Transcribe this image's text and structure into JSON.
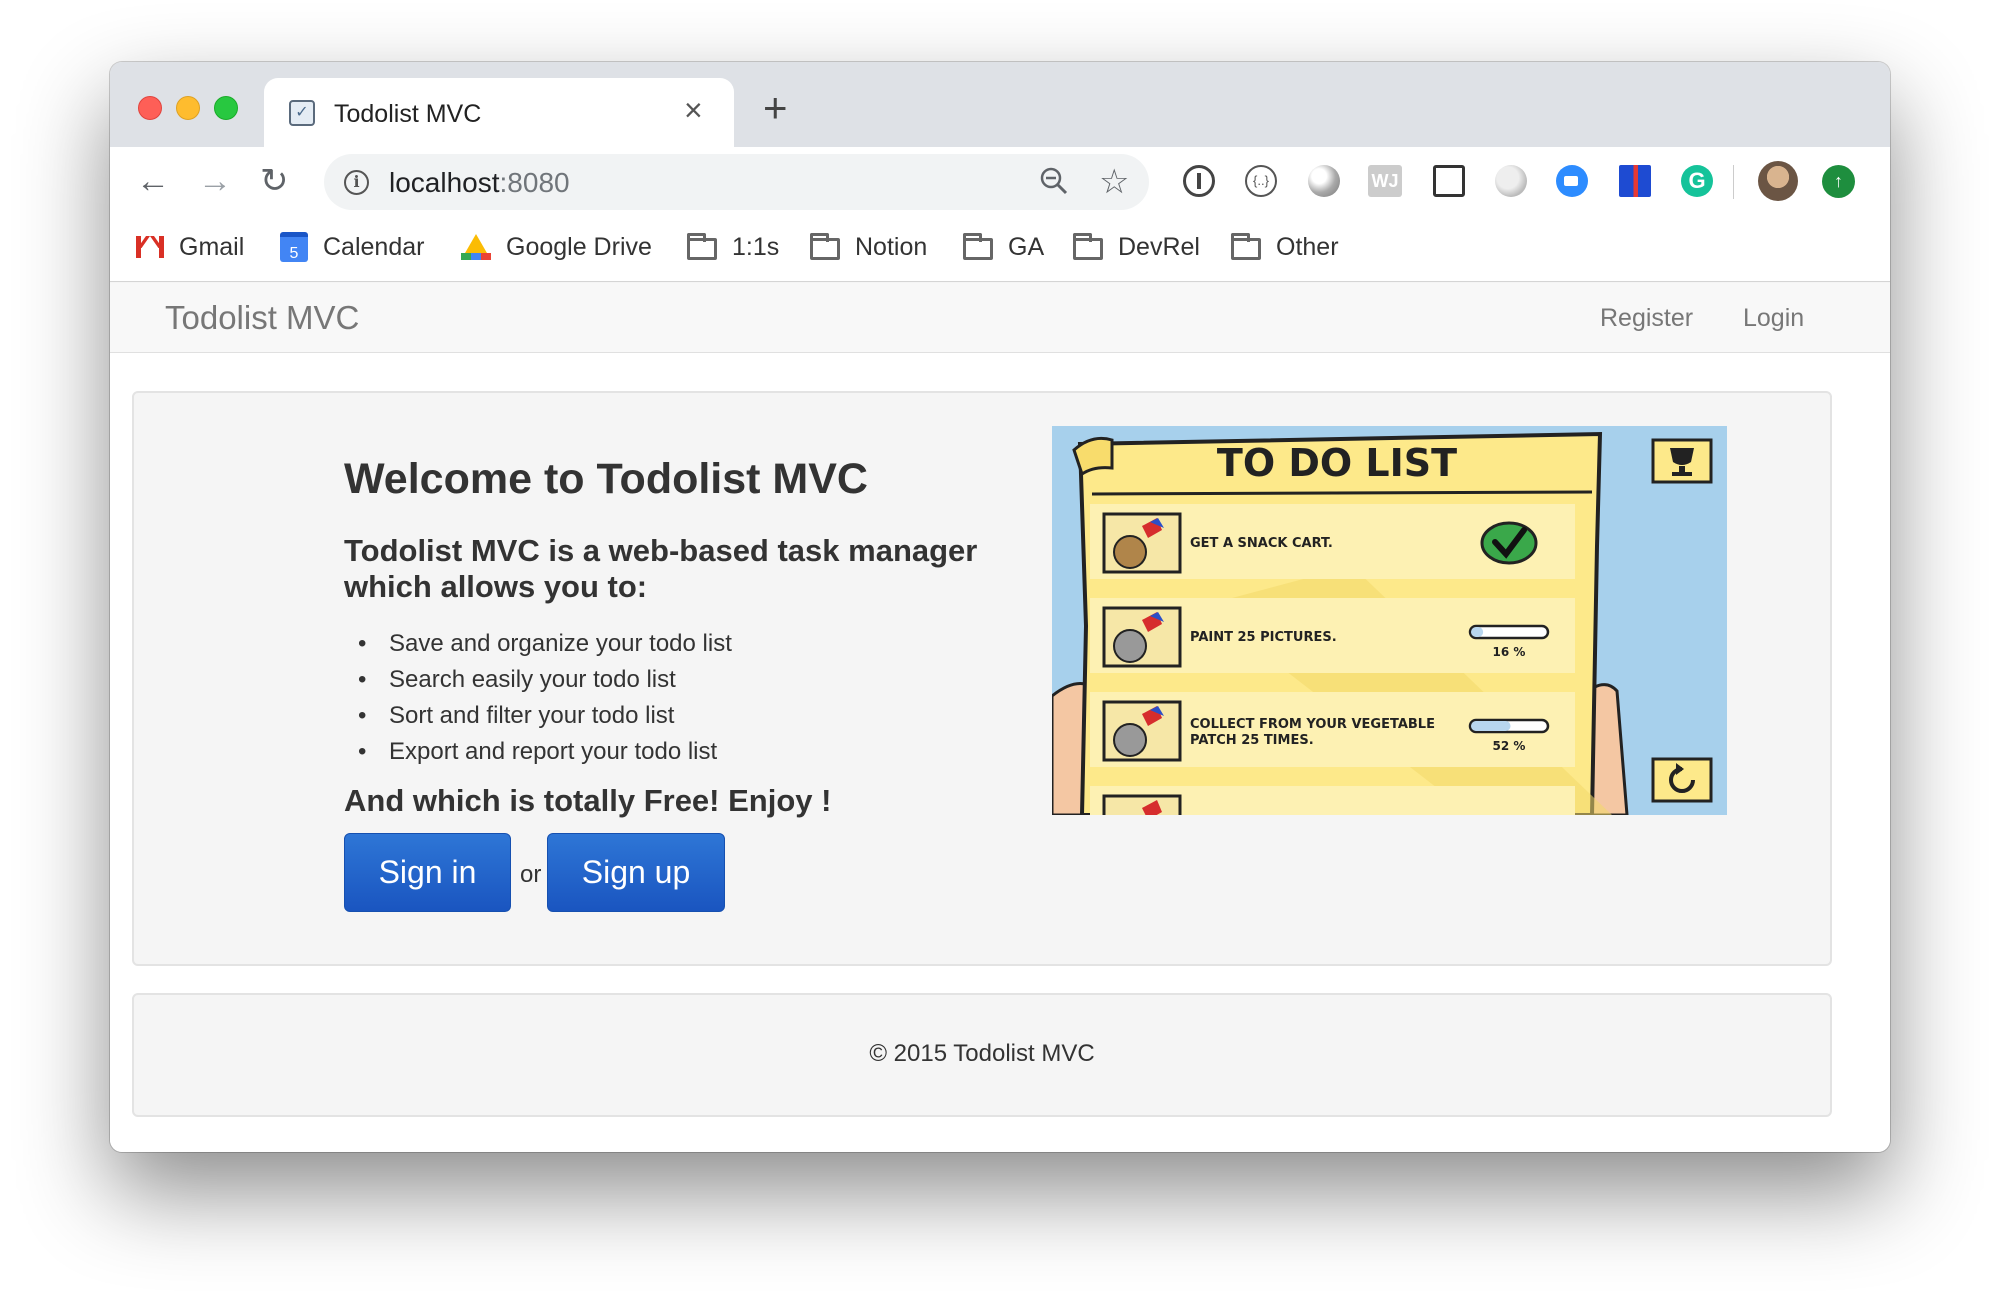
{
  "browser": {
    "tab_title": "Todolist MVC",
    "url_host": "localhost",
    "url_port": ":8080",
    "bookmarks": [
      "Gmail",
      "Calendar",
      "Google Drive",
      "1:1s",
      "Notion",
      "GA",
      "DevRel",
      "Other"
    ],
    "calendar_day": "5"
  },
  "navbar": {
    "brand": "Todolist MVC",
    "links": [
      "Register",
      "Login"
    ]
  },
  "hero": {
    "title": "Welcome to Todolist MVC",
    "subtitle": "Todolist MVC is a web-based task manager which allows you to:",
    "features": [
      "Save and organize your todo list",
      "Search easily your todo list",
      "Sort and filter your todo list",
      "Export and report your todo list"
    ],
    "tagline": "And which is totally Free! Enjoy !",
    "signin_label": "Sign in",
    "or_label": "or",
    "signup_label": "Sign up"
  },
  "illustration": {
    "heading": "TO DO LIST",
    "items": [
      {
        "text_line1": "GET A SNACK CART.",
        "text_line2": "",
        "progress_label": "",
        "progress": 1.0
      },
      {
        "text_line1": "PAINT 25 PICTURES.",
        "text_line2": "",
        "progress_label": "16 %",
        "progress": 0.16
      },
      {
        "text_line1": "COLLECT FROM YOUR VEGETABLE",
        "text_line2": "PATCH 25 TIMES.",
        "progress_label": "52 %",
        "progress": 0.52
      }
    ]
  },
  "footer": {
    "copyright": "© 2015 Todolist MVC"
  },
  "colors": {
    "primary_button": "#1a55c0",
    "jumbotron_bg": "#f5f5f5",
    "illustration_sky": "#a7d0ec",
    "paper": "#fde98a"
  }
}
